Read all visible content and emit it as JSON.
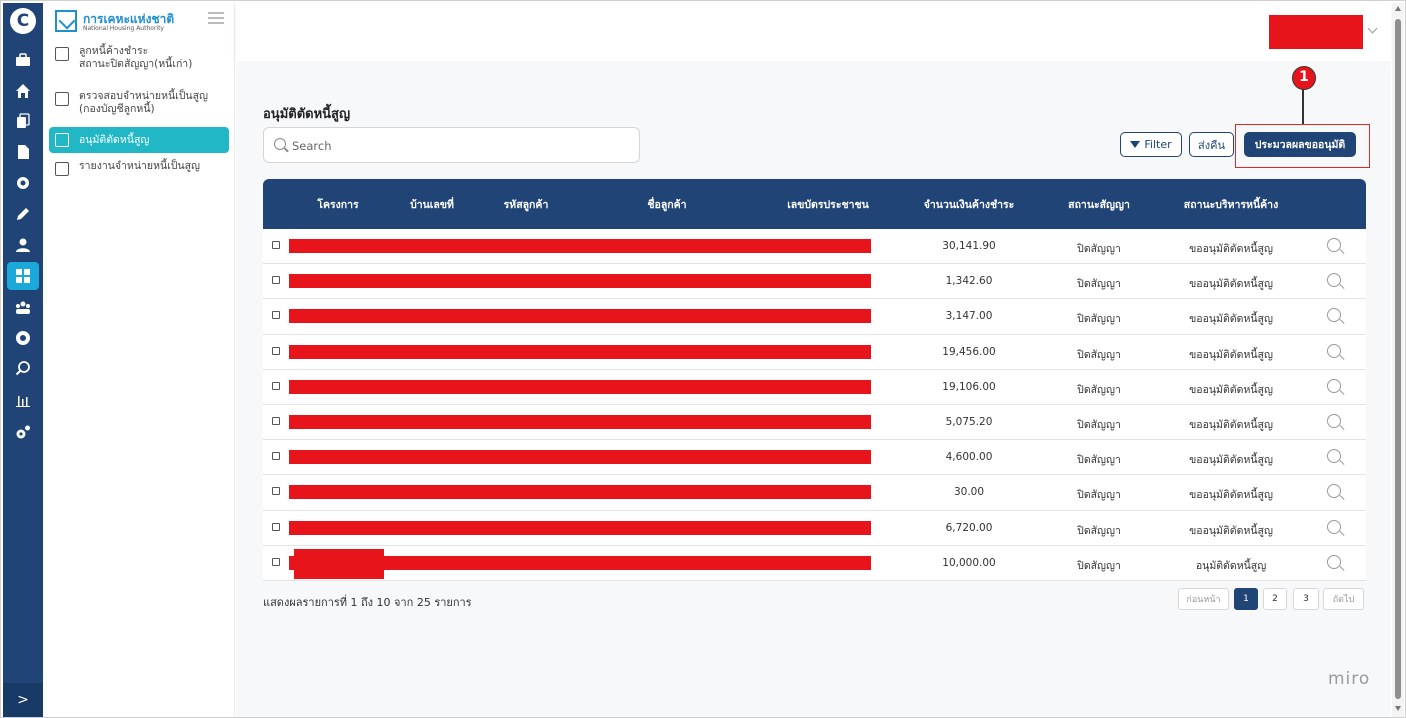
{
  "sidebar": {
    "brand_name": "การเคหะแห่งชาติ",
    "brand_sub": "National Housing Authority",
    "items": [
      {
        "label": "ลูกหนี้ค้างชำระ\nสถานะปิดสัญญา(หนี้เก่า)",
        "icon": "calendar-icon",
        "active": false
      },
      {
        "label": "ตรวจสอบจำหน่ายหนี้เป็นสูญ\n(กองบัญชีลูกหนี้)",
        "icon": "document-icon",
        "active": false
      },
      {
        "label": "อนุมัติตัดหนี้สูญ",
        "icon": "approve-document-icon",
        "active": true
      },
      {
        "label": "รายงานจำหน่ายหนี้เป็นสูญ",
        "icon": "table-icon",
        "active": false
      }
    ]
  },
  "rail": {
    "icons": [
      "briefcase-icon",
      "home-icon",
      "copy-icon",
      "file-icon",
      "settings-gear-icon",
      "edit-icon",
      "user-icon",
      "dashboard-icon",
      "team-icon",
      "shield-gear-icon",
      "search-icon",
      "bar-chart-icon",
      "cogs-icon"
    ],
    "active_icon": "dashboard-icon",
    "expand_label": ">"
  },
  "page": {
    "title": "อนุมัติตัดหนี้สูญ",
    "search_placeholder": "Search"
  },
  "toolbar": {
    "filter_label": "Filter",
    "return_label": "ส่งคืน",
    "process_label": "ประมวลผลขออนุมัติ"
  },
  "annotation": {
    "badge": "1",
    "color": "#e32626"
  },
  "table": {
    "headers": [
      "โครงการ",
      "บ้านเลขที่",
      "รหัสลูกค้า",
      "ชื่อลูกค้า",
      "เลขบัตรประชาชน",
      "จำนวนเงินค้างชำระ",
      "สถานะสัญญา",
      "สถานะบริหารหนี้ค้าง"
    ],
    "rows": [
      {
        "amount": "30,141.90",
        "contract_status": "ปิดสัญญา",
        "debt_status": "ขออนุมัติตัดหนี้สูญ"
      },
      {
        "amount": "1,342.60",
        "contract_status": "ปิดสัญญา",
        "debt_status": "ขออนุมัติตัดหนี้สูญ"
      },
      {
        "amount": "3,147.00",
        "contract_status": "ปิดสัญญา",
        "debt_status": "ขออนุมัติตัดหนี้สูญ"
      },
      {
        "amount": "19,456.00",
        "contract_status": "ปิดสัญญา",
        "debt_status": "ขออนุมัติตัดหนี้สูญ"
      },
      {
        "amount": "19,106.00",
        "contract_status": "ปิดสัญญา",
        "debt_status": "ขออนุมัติตัดหนี้สูญ"
      },
      {
        "amount": "5,075.20",
        "contract_status": "ปิดสัญญา",
        "debt_status": "ขออนุมัติตัดหนี้สูญ"
      },
      {
        "amount": "4,600.00",
        "contract_status": "ปิดสัญญา",
        "debt_status": "ขออนุมัติตัดหนี้สูญ"
      },
      {
        "amount": "30.00",
        "contract_status": "ปิดสัญญา",
        "debt_status": "ขออนุมัติตัดหนี้สูญ"
      },
      {
        "amount": "6,720.00",
        "contract_status": "ปิดสัญญา",
        "debt_status": "ขออนุมัติตัดหนี้สูญ"
      },
      {
        "amount": "10,000.00",
        "contract_status": "ปิดสัญญา",
        "debt_status": "อนุมัติตัดหนี้สูญ"
      }
    ]
  },
  "pagination": {
    "summary": "แสดงผลรายการที่ 1 ถึง 10 จาก 25 รายการ",
    "prev_label": "ก่อนหน้า",
    "pages": [
      "1",
      "2",
      "3"
    ],
    "current_page": "1",
    "next_label": "ถัดไป"
  },
  "watermark": "miro",
  "colors": {
    "navy": "#1f4475",
    "teal_active": "#21b7c7",
    "redaction": "#e8141b"
  }
}
